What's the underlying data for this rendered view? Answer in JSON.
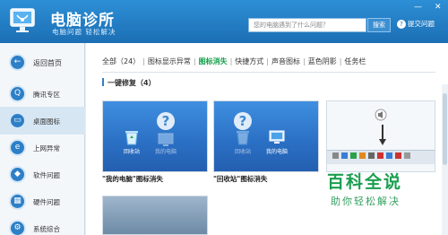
{
  "app": {
    "title": "电脑诊所",
    "slogan": "电脑问题 轻松解决",
    "search_placeholder": "您的电脑遇到了什么问题？",
    "search_button": "搜索",
    "feedback": "提交问题",
    "window_controls": [
      "—",
      "✕"
    ]
  },
  "sidebar": {
    "items": [
      {
        "label": "返回首页",
        "icon": "back-arrow-icon",
        "glyph": "←"
      },
      {
        "label": "腾讯专区",
        "icon": "penguin-icon",
        "glyph": "Q"
      },
      {
        "label": "桌面图标",
        "icon": "monitor-icon",
        "glyph": "▭",
        "active": true
      },
      {
        "label": "上网异常",
        "icon": "ie-icon",
        "glyph": "e"
      },
      {
        "label": "软件问题",
        "icon": "software-icon",
        "glyph": "◆"
      },
      {
        "label": "硬件问题",
        "icon": "hardware-icon",
        "glyph": "▦"
      },
      {
        "label": "系统综合",
        "icon": "system-icon",
        "glyph": "⚙"
      }
    ]
  },
  "tabs": [
    {
      "label": "全部（24）"
    },
    {
      "label": "图标显示异常"
    },
    {
      "label": "图标消失",
      "active": true
    },
    {
      "label": "快捷方式"
    },
    {
      "label": "声音图标"
    },
    {
      "label": "蓝色阴影"
    },
    {
      "label": "任务栏"
    }
  ],
  "fix_label": "一键修复（4）",
  "cards": [
    {
      "title": "\"我的电脑\"图标消失",
      "icons": [
        "回收站",
        "我的电脑"
      ]
    },
    {
      "title": "\"回收站\"图标消失",
      "icons": [
        "回收站",
        "我的电脑"
      ]
    }
  ],
  "watermark": {
    "title": "百科全说",
    "subtitle": "助你轻松解决"
  },
  "colors": {
    "accent": "#1c6fb4",
    "active_tab": "#13a04b",
    "watermark": "#1b9e4f"
  }
}
